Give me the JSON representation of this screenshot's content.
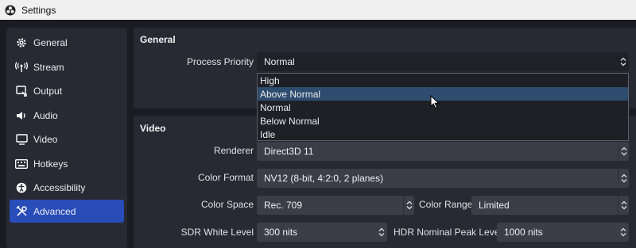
{
  "window": {
    "title": "Settings"
  },
  "sidebar": {
    "items": [
      {
        "label": "General",
        "icon": "gear-icon",
        "active": false
      },
      {
        "label": "Stream",
        "icon": "antenna-icon",
        "active": false
      },
      {
        "label": "Output",
        "icon": "output-icon",
        "active": false
      },
      {
        "label": "Audio",
        "icon": "speaker-icon",
        "active": false
      },
      {
        "label": "Video",
        "icon": "monitor-icon",
        "active": false
      },
      {
        "label": "Hotkeys",
        "icon": "keyboard-icon",
        "active": false
      },
      {
        "label": "Accessibility",
        "icon": "accessibility-icon",
        "active": false
      },
      {
        "label": "Advanced",
        "icon": "tools-icon",
        "active": true
      }
    ]
  },
  "general": {
    "title": "General",
    "process_priority": {
      "label": "Process Priority",
      "value": "Normal",
      "options": [
        "High",
        "Above Normal",
        "Normal",
        "Below Normal",
        "Idle"
      ],
      "hovered": "Above Normal"
    }
  },
  "video": {
    "title": "Video",
    "renderer": {
      "label": "Renderer",
      "value": "Direct3D 11"
    },
    "color_format": {
      "label": "Color Format",
      "value": "NV12 (8-bit, 4:2:0, 2 planes)"
    },
    "color_space": {
      "label": "Color Space",
      "value": "Rec. 709"
    },
    "color_range": {
      "label": "Color Range",
      "value": "Limited"
    },
    "sdr_white_level": {
      "label": "SDR White Level",
      "value": "300 nits"
    },
    "hdr_nominal_peak": {
      "label": "HDR Nominal Peak Level",
      "value": "1000 nits"
    }
  },
  "colors": {
    "accent": "#284cb8",
    "panel": "#272a33",
    "background": "#1b1c22",
    "hover": "#2e4c6e"
  }
}
